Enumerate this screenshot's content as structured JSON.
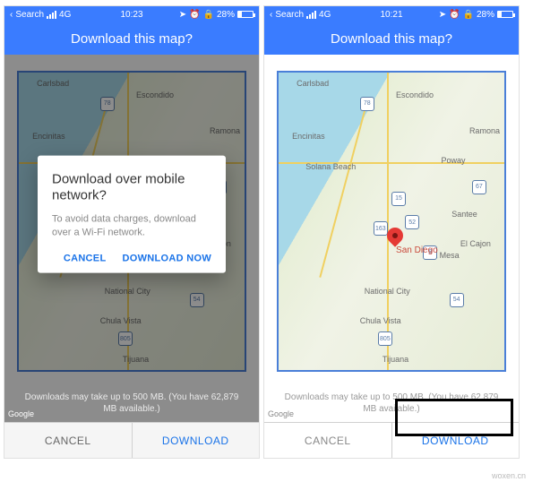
{
  "status": {
    "back": "Search",
    "network": "4G",
    "time_left": "10:23",
    "time_right": "10:21",
    "battery": "28%"
  },
  "header": {
    "title": "Download this map?"
  },
  "cities": {
    "carlsbad": "Carlsbad",
    "escondido": "Escondido",
    "encinitas": "Encinitas",
    "solana": "Solana Beach",
    "poway": "Poway",
    "ramona": "Ramona",
    "santee": "Santee",
    "elcajon": "El Cajon",
    "lamesa": "La Mesa",
    "national": "National City",
    "chula": "Chula Vista",
    "tijuana": "Tijuana",
    "sandiego": "San Diego"
  },
  "routes": {
    "r78": "78",
    "r15": "15",
    "r52": "52",
    "r8": "8",
    "r805": "805",
    "r163": "163",
    "r54": "54",
    "r67": "67"
  },
  "footnote": "Downloads may take up to 500 MB. (You have 62,879 MB available.)",
  "bottom": {
    "cancel": "CANCEL",
    "download": "DOWNLOAD"
  },
  "dialog": {
    "title": "Download over mobile network?",
    "body": "To avoid data charges, download over a Wi-Fi network.",
    "cancel": "CANCEL",
    "now": "DOWNLOAD NOW"
  },
  "brand": "Google",
  "watermark": "woxen.cn"
}
